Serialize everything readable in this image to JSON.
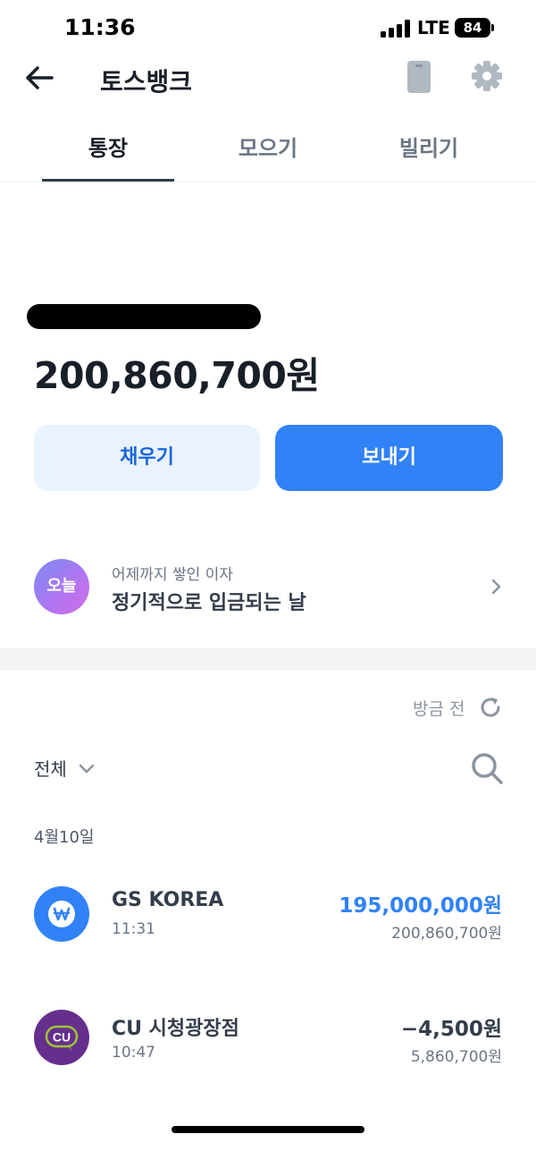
{
  "status_bar": {
    "time": "11:36",
    "network": "LTE",
    "battery": "84"
  },
  "header": {
    "title": "토스뱅크",
    "icons": [
      "back-arrow-icon",
      "card-icon",
      "gear-icon"
    ]
  },
  "tabs": [
    {
      "label": "통장",
      "active": true
    },
    {
      "label": "모으기",
      "active": false
    },
    {
      "label": "빌리기",
      "active": false
    }
  ],
  "account": {
    "balance": "200,860,700원"
  },
  "actions": {
    "fill_label": "채우기",
    "send_label": "보내기"
  },
  "interest": {
    "badge": "오늘",
    "subtitle": "어제까지 쌓인 이자",
    "title": "정기적으로 입금되는 날"
  },
  "list_controls": {
    "before_payment": "방금 전",
    "filter_label": "전체"
  },
  "date_group": "4월10일",
  "transactions": [
    {
      "name": "GS KOREA",
      "time": "11:31",
      "amount": "195,000,000원",
      "balance_after": "200,860,700원",
      "icon": "won-icon",
      "amount_color": "#3182f6"
    },
    {
      "name": "CU 시청광장점",
      "time": "10:47",
      "amount": "−4,500원",
      "balance_after": "5,860,700원",
      "icon": "cu-logo",
      "amount_color": "#333d4b"
    }
  ],
  "colors": {
    "primary": "#3182f6",
    "primary_light": "#e8f3ff",
    "text_dark": "#191f28",
    "text_gray": "#6b7684",
    "cu_purple": "#652f8d",
    "cu_green": "#a0c334"
  }
}
